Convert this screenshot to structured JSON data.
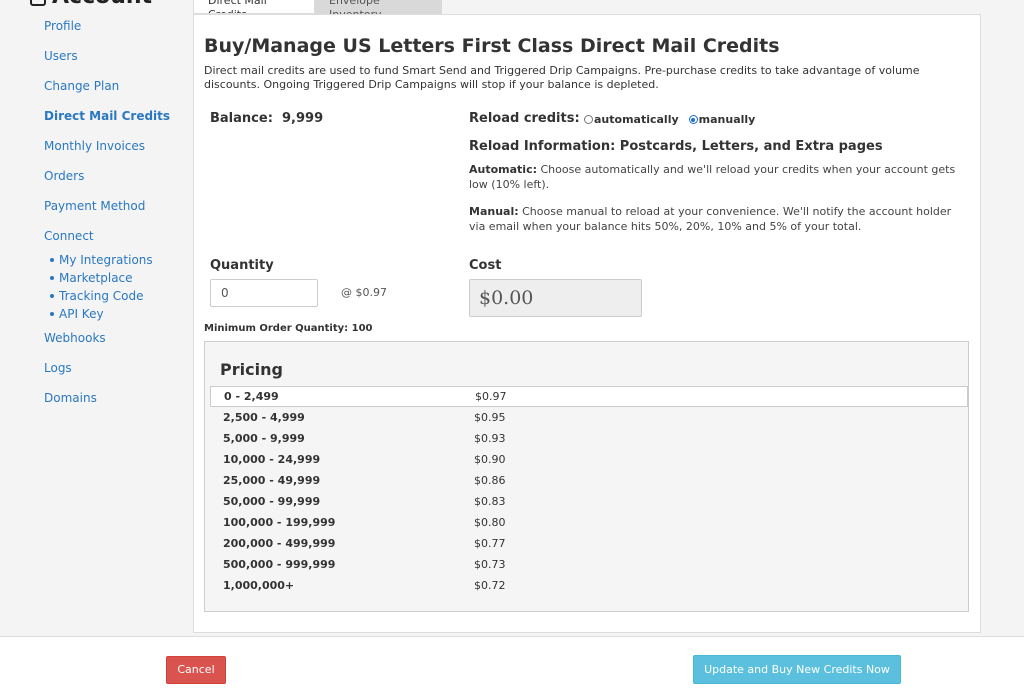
{
  "sidebar": {
    "header": "Account",
    "items": [
      {
        "label": "Profile"
      },
      {
        "label": "Users"
      },
      {
        "label": "Change Plan"
      },
      {
        "label": "Direct Mail Credits",
        "active": true
      },
      {
        "label": "Monthly Invoices"
      },
      {
        "label": "Orders"
      },
      {
        "label": "Payment Method"
      },
      {
        "label": "Connect"
      }
    ],
    "connect_sub": [
      {
        "label": "My Integrations"
      },
      {
        "label": "Marketplace"
      },
      {
        "label": "Tracking Code"
      },
      {
        "label": "API Key"
      }
    ],
    "items_after": [
      {
        "label": "Webhooks"
      },
      {
        "label": "Logs"
      },
      {
        "label": "Domains"
      }
    ]
  },
  "tabs": [
    {
      "label": "Direct Mail Credits",
      "active": true
    },
    {
      "label": "Envelope Inventory",
      "active": false
    }
  ],
  "main": {
    "title": "Buy/Manage US Letters First Class Direct Mail Credits",
    "description": "Direct mail credits are used to fund Smart Send and Triggered Drip Campaigns. Pre-purchase credits to take advantage of volume discounts. Ongoing Triggered Drip Campaigns will stop if your balance is depleted.",
    "balance_label": "Balance:",
    "balance_value": "9,999",
    "reload_label": "Reload credits:",
    "reload_options": [
      {
        "label": "automatically",
        "checked": false
      },
      {
        "label": "manually",
        "checked": true
      }
    ],
    "reload_info_title": "Reload Information: Postcards, Letters, and Extra pages",
    "automatic_label": "Automatic:",
    "automatic_text": " Choose automatically and we'll reload your credits when your account gets low (10% left).",
    "manual_label": "Manual:",
    "manual_text": " Choose manual to reload at your convenience. We'll notify the account holder via email when your balance hits 50%, 20%, 10% and 5% of your total.",
    "quantity_label": "Quantity",
    "quantity_value": "0",
    "at_price": "@ $0.97",
    "cost_label": "Cost",
    "cost_value": "$0.00",
    "min_order": "Minimum Order Quantity: 100"
  },
  "pricing": {
    "title": "Pricing",
    "rows": [
      {
        "range": "0 - 2,499",
        "price": "$0.97"
      },
      {
        "range": "2,500 - 4,999",
        "price": "$0.95"
      },
      {
        "range": "5,000 - 9,999",
        "price": "$0.93"
      },
      {
        "range": "10,000 - 24,999",
        "price": "$0.90"
      },
      {
        "range": "25,000 - 49,999",
        "price": "$0.86"
      },
      {
        "range": "50,000 - 99,999",
        "price": "$0.83"
      },
      {
        "range": "100,000 - 199,999",
        "price": "$0.80"
      },
      {
        "range": "200,000 - 499,999",
        "price": "$0.77"
      },
      {
        "range": "500,000 - 999,999",
        "price": "$0.73"
      },
      {
        "range": "1,000,000+",
        "price": "$0.72"
      }
    ]
  },
  "footer": {
    "cancel_label": "Cancel",
    "update_label": "Update and Buy New Credits Now"
  },
  "colors": {
    "link": "#2a78c2",
    "cancel": "#d9534f",
    "update": "#5bc0de"
  }
}
